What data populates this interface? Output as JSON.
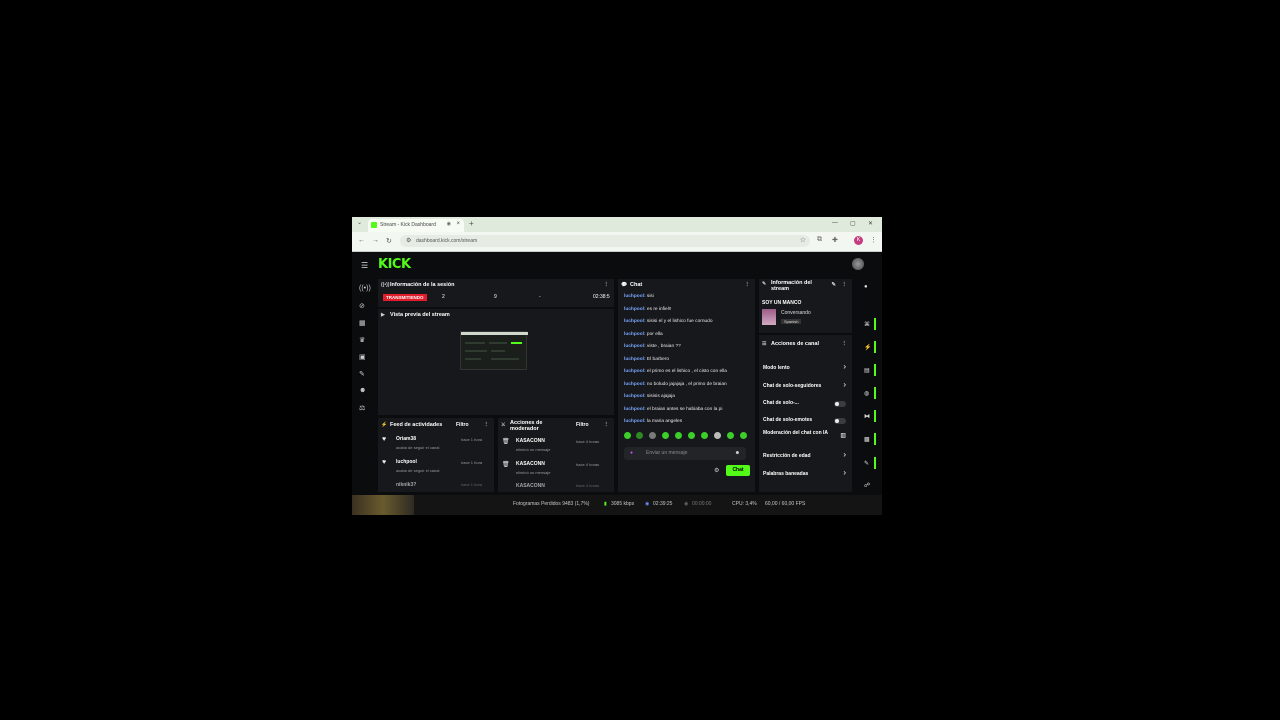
{
  "browser": {
    "tab_title": "Stream - Kick Dashboard",
    "new_tab": "+",
    "url": "dashboard.kick.com/stream",
    "profile_initial": "K"
  },
  "header": {
    "logo": "KICK"
  },
  "session": {
    "title": "Información de la sesión",
    "live_badge": "TRANSMITIENDO",
    "viewers": "2",
    "followers": "9",
    "subs": "-",
    "duration": "02:38:5"
  },
  "preview": {
    "title": "Vista previa del stream"
  },
  "activity": {
    "title": "Feed de actividades",
    "filter": "Filtro",
    "items": [
      {
        "name": "Oriam38",
        "time": "hace 1 hora",
        "desc": "acaba de seguir el canal"
      },
      {
        "name": "luchpool",
        "time": "hace 1 hora",
        "desc": "acaba de seguir el canal"
      },
      {
        "name": "niknik3?",
        "time": "hace 1 hora",
        "desc": ""
      }
    ]
  },
  "modactions": {
    "title": "Acciones de moderador",
    "filter": "Filtro",
    "items": [
      {
        "name": "KASACONN",
        "time": "hace 4 horas",
        "desc": "eliminó un mensaje"
      },
      {
        "name": "KASACONN",
        "time": "hace 4 horas",
        "desc": "eliminó un mensaje"
      },
      {
        "name": "KASACONN",
        "time": "hace 4 horas",
        "desc": ""
      }
    ]
  },
  "chat": {
    "title": "Chat",
    "messages": [
      {
        "user": "luchpool:",
        "text": " sisi"
      },
      {
        "user": "luchpool:",
        "text": " es re infiel!!"
      },
      {
        "user": "luchpool:",
        "text": " sisisi el y el lishico fue cornudo"
      },
      {
        "user": "luchpool:",
        "text": " por ella"
      },
      {
        "user": "luchpool:",
        "text": " viste , braian ??"
      },
      {
        "user": "luchpool:",
        "text": " El barbero"
      },
      {
        "user": "luchpool:",
        "text": " el primo es el lishico , el cisto con ella"
      },
      {
        "user": "luchpool:",
        "text": " no boludo jajajaja , el primo de braian"
      },
      {
        "user": "luchpool:",
        "text": " sisisis ajajaja"
      },
      {
        "user": "luchpool:",
        "text": " el braian antes se habiaba con la pi"
      },
      {
        "user": "luchpool:",
        "text": " la maria angeles"
      }
    ],
    "input_placeholder": "Enviar un mensaje",
    "send_label": "Chat"
  },
  "stream_info": {
    "title": "Información del stream",
    "stream_title": "SOY UN MANCO",
    "category": "Conversando",
    "language": "Spanish"
  },
  "channel_actions": {
    "title": "Acciones de canal",
    "items": [
      {
        "label": "Modo lento",
        "control": "arrow"
      },
      {
        "label": "Chat de solo-seguidores",
        "control": "arrow"
      },
      {
        "label": "Chat de solo-...",
        "control": "toggle"
      },
      {
        "label": "Chat de solo-emotes",
        "control": "toggle"
      },
      {
        "label": "Moderación del chat con IA",
        "control": "chart"
      },
      {
        "label": "Restricción de edad",
        "control": "arrow"
      },
      {
        "label": "Palabras baneadas",
        "control": "arrow"
      }
    ]
  },
  "obs_status": {
    "dropped": "Fotogramas Perdidos 9483 (1,7%)",
    "bitrate": "3085 kbps",
    "live_time": "02:39:25",
    "rec_time": "00:00:00",
    "cpu": "CPU: 3,4%",
    "fps": "60,00 / 60,00 FPS"
  }
}
